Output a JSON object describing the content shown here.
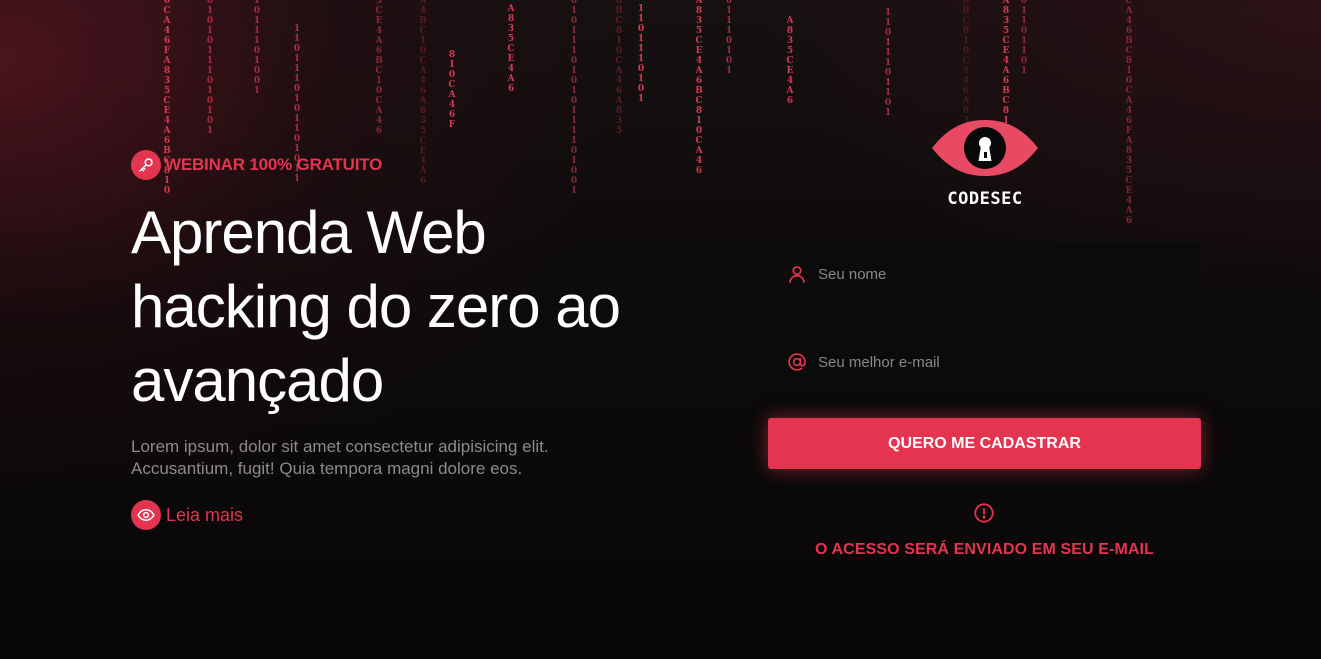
{
  "colors": {
    "accent": "#e3354f",
    "background": "#0a0909",
    "field_bg": "#0c0b0b"
  },
  "hero": {
    "badge_icon": "key-icon",
    "badge": "WEBINAR 100% GRATUITO",
    "headline": "Aprenda Web hacking do zero ao avançado",
    "lead": "Lorem ipsum, dolor sit amet consectetur adipisicing elit. Accusantium, fugit! Quia tempora magni dolore eos.",
    "read_more_icon": "eye-icon",
    "read_more": "Leia mais"
  },
  "brand": {
    "logo_icon": "eye-keyhole-logo-icon",
    "name": "CODESEC"
  },
  "form": {
    "name_icon": "user-icon",
    "name_placeholder": "Seu nome",
    "email_icon": "at-sign-icon",
    "email_placeholder": "Seu melhor e-mail",
    "submit": "QUERO ME CADASTRAR",
    "notice_icon": "alert-circle-icon",
    "notice": "O ACESSO SERÁ ENVIADO EM SEU E-MAIL"
  },
  "background_rain": [
    "0CA46FA835CE4A6BC810",
    "01010111010101",
    "1011101001",
    "1101110101101011",
    "5CE4A6BC10CA46",
    "A4BC10CA46A835CE4A6",
    "810CA46F",
    "A835CE4A6",
    "01011101010111101001",
    "6BC810CA46A835",
    "1101110101",
    "A835CE4A6BC810CA46",
    "01110101",
    "A835CE4A6",
    "11011101101",
    "6BC810CA46A835",
    "A835CE4A6BC810",
    "01101101",
    "CA46BC810CA46FA835CE4A6"
  ]
}
